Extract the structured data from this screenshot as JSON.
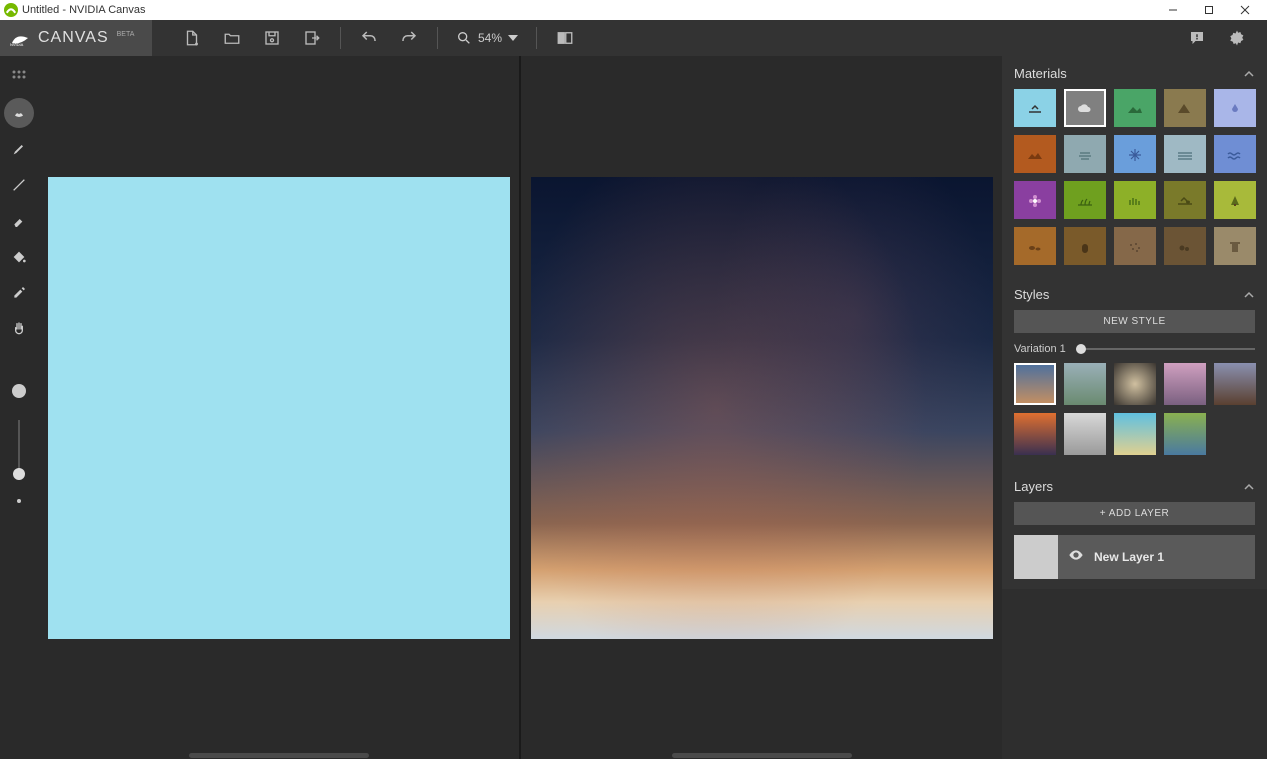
{
  "window": {
    "title": "Untitled - NVIDIA Canvas"
  },
  "brand": {
    "name": "CANVAS",
    "badge": "BETA",
    "logo_label": "nvidia"
  },
  "toolbar": {
    "new": "New",
    "open": "Open",
    "save": "Save",
    "export": "Export",
    "undo": "Undo",
    "redo": "Redo",
    "zoom_level": "54%",
    "compare": "Compare",
    "feedback": "Feedback",
    "settings": "Settings"
  },
  "left_tools": {
    "grid": "Grid",
    "material_fill": "Material Fill",
    "brush": "Brush",
    "line": "Line",
    "eraser": "Eraser",
    "fill": "Fill",
    "eyedropper": "Eyedropper",
    "pan": "Pan"
  },
  "panels": {
    "materials": {
      "title": "Materials",
      "items": [
        {
          "name": "sky",
          "color": "#8bd2e6"
        },
        {
          "name": "cloud",
          "color": "#808080",
          "selected": true
        },
        {
          "name": "hill",
          "color": "#4aa567"
        },
        {
          "name": "mountain",
          "color": "#8a7a4f"
        },
        {
          "name": "water-drop",
          "color": "#a9b6e8"
        },
        {
          "name": "dirt",
          "color": "#b35a1f"
        },
        {
          "name": "fog",
          "color": "#8fa9b0"
        },
        {
          "name": "snow",
          "color": "#6a9edb"
        },
        {
          "name": "water",
          "color": "#9fb9c4"
        },
        {
          "name": "sea",
          "color": "#6f8ed4"
        },
        {
          "name": "flower",
          "color": "#8a3fa0"
        },
        {
          "name": "grass",
          "color": "#6fa01f"
        },
        {
          "name": "bush",
          "color": "#8db028"
        },
        {
          "name": "ground",
          "color": "#7a7a2a"
        },
        {
          "name": "tree",
          "color": "#a8ba3a"
        },
        {
          "name": "mud",
          "color": "#a56a2a"
        },
        {
          "name": "wood",
          "color": "#7a5a2a"
        },
        {
          "name": "gravel",
          "color": "#856849"
        },
        {
          "name": "rock",
          "color": "#6b5435"
        },
        {
          "name": "building",
          "color": "#9a8a6a"
        }
      ]
    },
    "styles": {
      "title": "Styles",
      "new_btn": "NEW STYLE",
      "variation_label": "Variation 1",
      "thumbs": [
        {
          "name": "style-1",
          "selected": true,
          "bg": "linear-gradient(#4a6fa0,#c89060)"
        },
        {
          "name": "style-2",
          "bg": "linear-gradient(#9ab0b8,#6a8a70)"
        },
        {
          "name": "style-3",
          "bg": "radial-gradient(circle,#d0c0a0,#3a3530)"
        },
        {
          "name": "style-4",
          "bg": "linear-gradient(#d0a0c0,#7a6080)"
        },
        {
          "name": "style-5",
          "bg": "linear-gradient(#8a90b0,#5a4030)"
        },
        {
          "name": "style-6",
          "bg": "linear-gradient(#e07030,#3a3050)"
        },
        {
          "name": "style-7",
          "bg": "linear-gradient(#d8d8d8,#9a9a9a)"
        },
        {
          "name": "style-8",
          "bg": "linear-gradient(#60c0e0,#e0d090)"
        },
        {
          "name": "style-9",
          "bg": "linear-gradient(#8ab050,#4a7aa0)"
        }
      ]
    },
    "layers": {
      "title": "Layers",
      "add_btn": "+ ADD LAYER",
      "items": [
        {
          "name": "New Layer 1"
        }
      ]
    }
  }
}
